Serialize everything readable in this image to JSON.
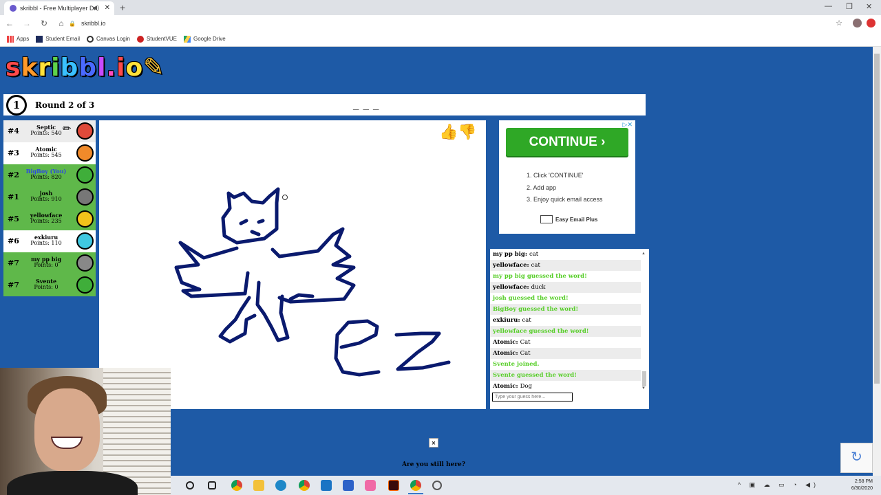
{
  "browser": {
    "tab_title": "skribbl - Free Multiplayer Dr",
    "url": "skribbl.io",
    "bookmarks": [
      "Apps",
      "Student Email",
      "Canvas Login",
      "StudentVUE",
      "Google Drive"
    ]
  },
  "game": {
    "logo": "skribbl.io",
    "round_text": "Round 2 of 3",
    "timer": "1",
    "word_hint": "_ _ _",
    "players": [
      {
        "rank": "#4",
        "name": "Septic",
        "points": "Points: 540",
        "avatar_color": "#e04a3a",
        "drawing": true,
        "highlight": false
      },
      {
        "rank": "#3",
        "name": "Atomic",
        "points": "Points: 545",
        "avatar_color": "#f08a2a",
        "drawing": false,
        "highlight": false
      },
      {
        "rank": "#2",
        "name": "BigBoy (You)",
        "points": "Points: 820",
        "avatar_color": "#3fae3a",
        "drawing": false,
        "highlight": true,
        "is_you": true
      },
      {
        "rank": "#1",
        "name": "josh",
        "points": "Points: 910",
        "avatar_color": "#777777",
        "drawing": false,
        "highlight": true
      },
      {
        "rank": "#5",
        "name": "yellowface",
        "points": "Points: 235",
        "avatar_color": "#f2c31a",
        "drawing": false,
        "highlight": true
      },
      {
        "rank": "#6",
        "name": "exkiuru",
        "points": "Points: 110",
        "avatar_color": "#3fc8e0",
        "drawing": false,
        "highlight": false
      },
      {
        "rank": "#7",
        "name": "my pp big",
        "points": "Points: 0",
        "avatar_color": "#888888",
        "drawing": false,
        "highlight": true
      },
      {
        "rank": "#7",
        "name": "Svente",
        "points": "Points: 0",
        "avatar_color": "#3fae3a",
        "drawing": false,
        "highlight": true
      }
    ],
    "chat": [
      {
        "type": "msg",
        "who": "my pp big",
        "text": "cat"
      },
      {
        "type": "msg",
        "who": "yellowface",
        "text": "cat"
      },
      {
        "type": "sys",
        "text": "my pp big guessed the word!"
      },
      {
        "type": "msg",
        "who": "yellowface",
        "text": "duck"
      },
      {
        "type": "sys",
        "text": "josh guessed the word!"
      },
      {
        "type": "sys",
        "text": "BigBoy guessed the word!"
      },
      {
        "type": "msg",
        "who": "exkiuru",
        "text": "cat"
      },
      {
        "type": "sys",
        "text": "yellowface guessed the word!"
      },
      {
        "type": "msg",
        "who": "Atomic",
        "text": "Cat"
      },
      {
        "type": "msg",
        "who": "Atomic",
        "text": "Cat"
      },
      {
        "type": "sys",
        "text": "Svente joined."
      },
      {
        "type": "sys",
        "text": "Svente guessed the word!"
      },
      {
        "type": "msg",
        "who": "Atomic",
        "text": "Dog"
      }
    ],
    "guess_placeholder": "Type your guess here...",
    "still_here": "Are you still here?",
    "still_here_close": "×"
  },
  "ad": {
    "button": "CONTINUE ›",
    "steps": [
      "1. Click 'CONTINUE'",
      "2. Add app",
      "3. Enjoy quick email access"
    ],
    "brand": "Easy Email Plus",
    "close": "▷✕"
  },
  "taskbar": {
    "time": "2:58 PM",
    "date": "6/30/2020"
  },
  "colors": {
    "page_bg": "#1e5aa6",
    "player_highlight": "#5fb84a",
    "chat_green": "#56ce27",
    "you_name": "#2d48e0",
    "drawing_ink": "#0a1a6e"
  }
}
